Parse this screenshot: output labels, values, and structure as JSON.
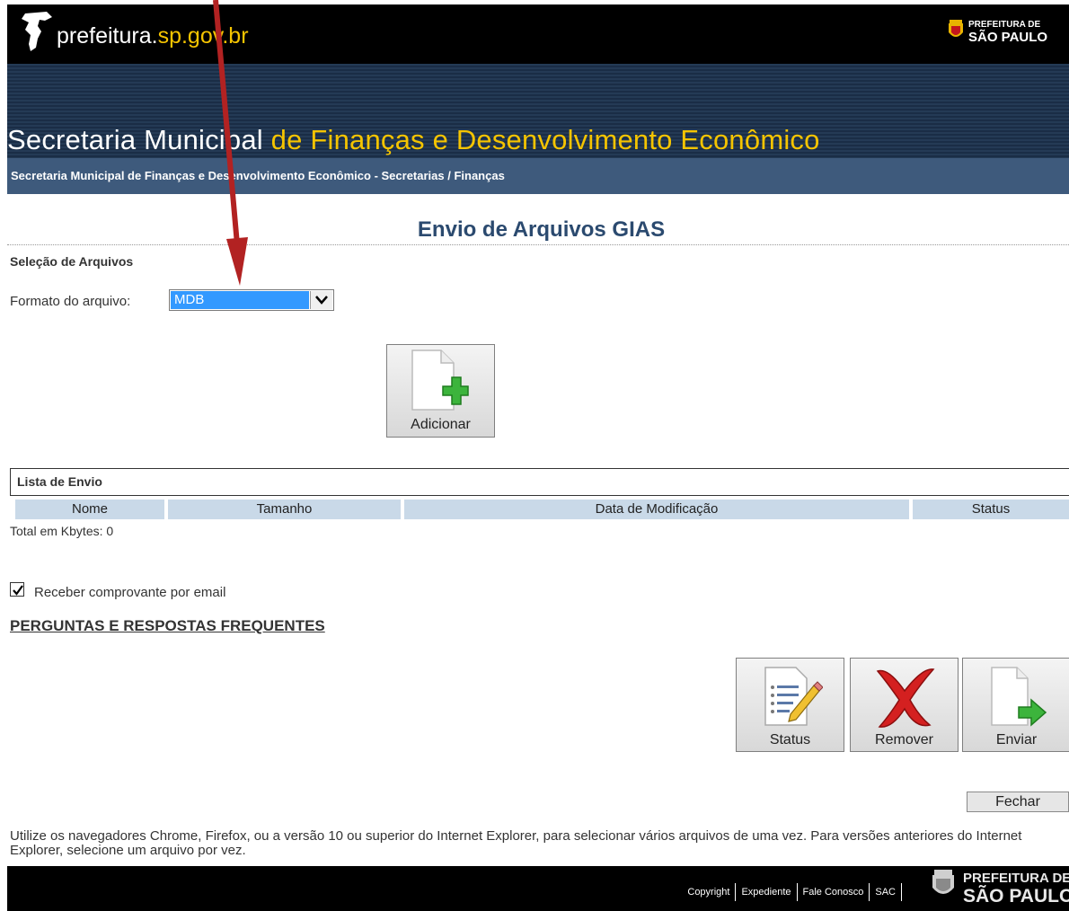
{
  "header": {
    "url_prefix": "prefeitura.",
    "url_highlight": "sp.gov.br",
    "logo_line1": "PREFEITURA DE",
    "logo_line2": "SÃO PAULO"
  },
  "banner": {
    "title_white": "Secretaria Municipal ",
    "title_yellow": "de Finanças e Desenvolvimento Econômico",
    "breadcrumb": "Secretaria Municipal de Finanças e Desenvolvimento Econômico - Secretarias / Finanças"
  },
  "page": {
    "title": "Envio de Arquivos GIAS",
    "section_title": "Seleção de Arquivos",
    "format_label": "Formato do arquivo:",
    "format_value": "MDB"
  },
  "buttons": {
    "add": "Adicionar",
    "status": "Status",
    "remove": "Remover",
    "send": "Enviar",
    "close": "Fechar"
  },
  "list": {
    "title": "Lista de Envio",
    "columns": [
      "Nome",
      "Tamanho",
      "Data de Modificação",
      "Status"
    ],
    "total": "Total em Kbytes: 0"
  },
  "options": {
    "email_receipt_label": "Receber comprovante por email",
    "email_receipt_checked": true
  },
  "faq_link": "PERGUNTAS E RESPOSTAS FREQUENTES",
  "note": "Utilize os navegadores Chrome, Firefox, ou a versão 10 ou superior do Internet Explorer, para selecionar vários arquivos de uma vez. Para versões anteriores do Internet Explorer, selecione um arquivo por vez.",
  "footer": {
    "links": [
      "Copyright",
      "Expediente",
      "Fale Conosco",
      "SAC"
    ],
    "logo_line1": "PREFEITURA DE",
    "logo_line2": "SÃO PAULO"
  },
  "colors": {
    "banner_navy": "#1a2d46",
    "breadcrumb_bar": "#3e5a7c",
    "accent_yellow": "#f5c400",
    "title_blue": "#2b4a6f",
    "annotation_arrow": "#b22222"
  }
}
